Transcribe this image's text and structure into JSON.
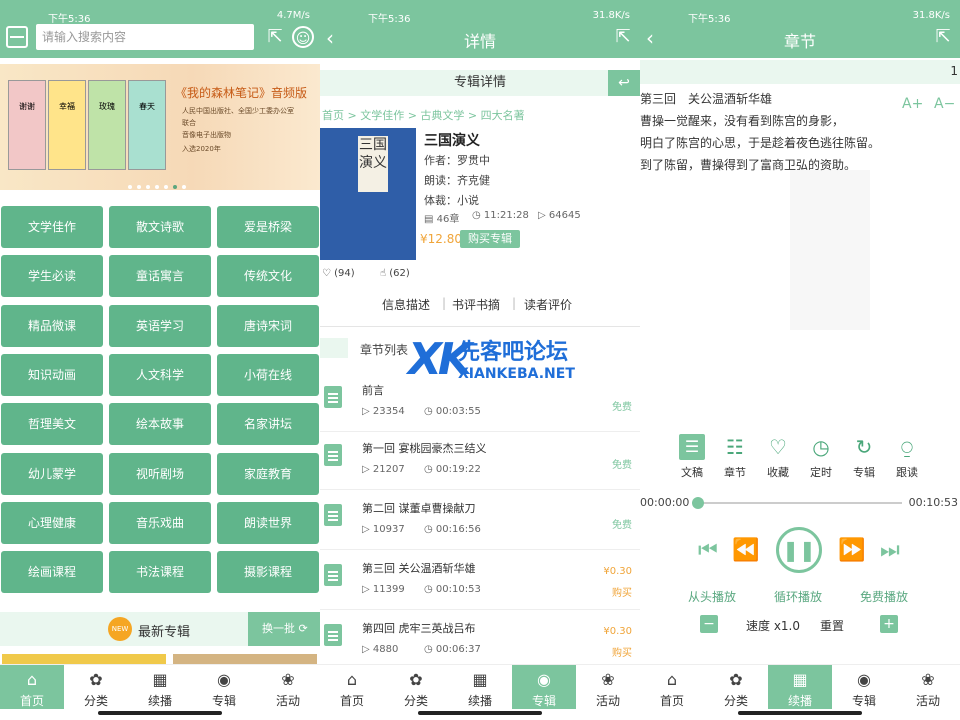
{
  "screen1": {
    "status_time": "下午5:36",
    "status_speed": "4.7M/s",
    "search_placeholder": "请输入搜索内容",
    "banner": {
      "title": "《我的森林笔记》音频版",
      "books": [
        "谢谢",
        "幸福",
        "玫瑰",
        "春天"
      ],
      "lines": [
        "人民中国出版社、全国少工委办公室",
        "联合",
        "音像电子出版物",
        "入选2020年"
      ]
    },
    "categories": [
      "文学佳作",
      "散文诗歌",
      "爱是桥梁",
      "学生必读",
      "童话寓言",
      "传统文化",
      "精品微课",
      "英语学习",
      "唐诗宋词",
      "知识动画",
      "人文科学",
      "小荷在线",
      "哲理美文",
      "绘本故事",
      "名家讲坛",
      "幼儿蒙学",
      "视听剧场",
      "家庭教育",
      "心理健康",
      "音乐戏曲",
      "朗读世界",
      "绘画课程",
      "书法课程",
      "摄影课程"
    ],
    "new_badge": "NEW",
    "latest_label": "最新专辑",
    "refresh_label": "换一批"
  },
  "screen2": {
    "status_time": "下午5:36",
    "status_speed": "31.8K/s",
    "title": "详情",
    "section_header": "专辑详情",
    "breadcrumb": "首页 > 文学佳作 > 古典文学 > 四大名著",
    "cover_text": "三国演义",
    "book_title": "三国演义",
    "author": "作者：罗贯中",
    "reader": "朗读：齐克健",
    "genre": "体裁：小说",
    "chapters": "46章",
    "duration": "11:21:28",
    "plays": "64645",
    "price": "¥12.80",
    "buy_label": "购买专辑",
    "likes": "(94)",
    "dislikes": "(62)",
    "subtabs": [
      "信息描述",
      "书评书摘",
      "读者评价"
    ],
    "chapter_list_label": "章节列表",
    "watermark": {
      "cn": "先客吧论坛",
      "en": "XIANKEBA.NET",
      "mark": "XK"
    },
    "rows": [
      {
        "title": "前言",
        "plays": "23354",
        "duration": "00:03:55",
        "price": "",
        "action": "免费"
      },
      {
        "title": "第一回 宴桃园豪杰三结义",
        "plays": "21207",
        "duration": "00:19:22",
        "price": "",
        "action": "免费"
      },
      {
        "title": "第二回 谋董卓曹操献刀",
        "plays": "10937",
        "duration": "00:16:56",
        "price": "",
        "action": "免费"
      },
      {
        "title": "第三回 关公温酒斩华雄",
        "plays": "11399",
        "duration": "00:10:53",
        "price": "¥0.30",
        "action": "购买"
      },
      {
        "title": "第四回 虎牢三英战吕布",
        "plays": "4880",
        "duration": "00:06:37",
        "price": "¥0.30",
        "action": "购买"
      }
    ]
  },
  "screen3": {
    "status_time": "下午5:36",
    "status_speed": "31.8K/s",
    "title": "章节",
    "chapter_number": "1",
    "text_lines": [
      "第三回　关公温酒斩华雄",
      "曹操一觉醒来，没有看到陈宫的身影，",
      "明白了陈宫的心思，于是趁着夜色逃往陈留。",
      "到了陈留，曹操得到了富商卫弘的资助。"
    ],
    "font_up": "A+",
    "font_down": "A−",
    "controls": [
      "文稿",
      "章节",
      "收藏",
      "定时",
      "专辑",
      "跟读"
    ],
    "time_elapsed": "00:00:00",
    "time_total": "00:10:53",
    "progress": 0.0,
    "modes": [
      "从头播放",
      "循环播放",
      "免费播放"
    ],
    "speed": "速度 x1.0",
    "reset": "重置"
  },
  "tabs": [
    "首页",
    "分类",
    "续播",
    "专辑",
    "活动"
  ],
  "active_tabs": {
    "screen1": 0,
    "screen2": 3,
    "screen3": 2
  },
  "colors": {
    "accent": "#7cc59e",
    "tile": "#60b58b",
    "price": "#f0a53a",
    "link": "#1f6ed8"
  }
}
